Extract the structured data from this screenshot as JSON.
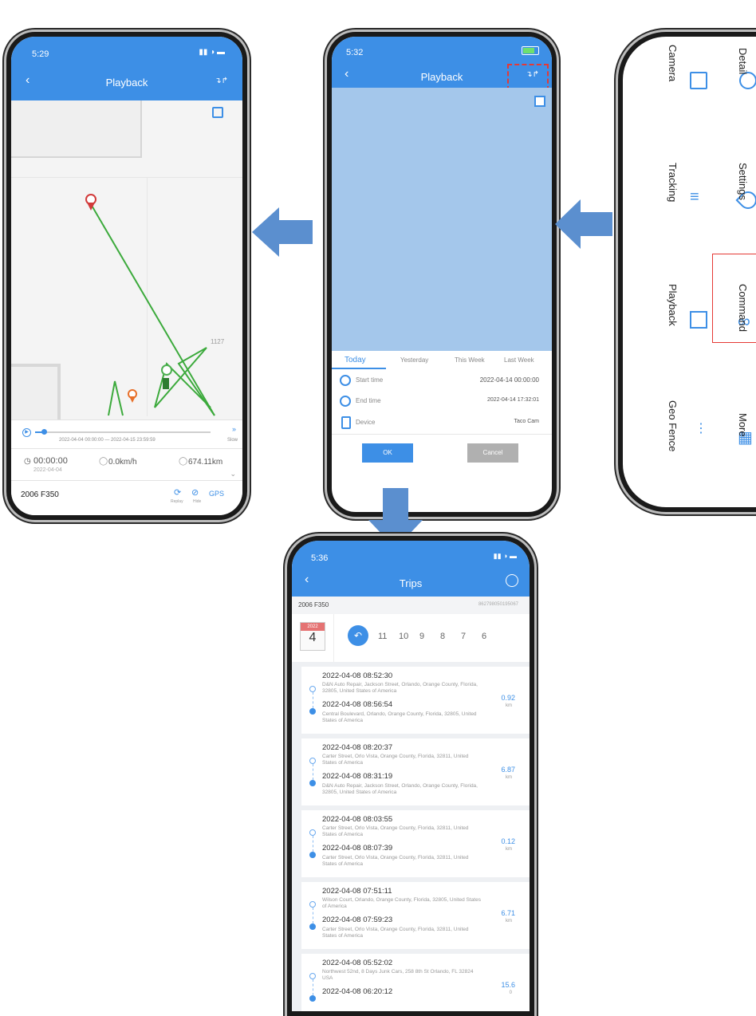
{
  "colors": {
    "brand": "#3d8fe6",
    "route": "#3caa3c",
    "arrow": "#5b8fcf",
    "highlight": "#e53935"
  },
  "left_phone": {
    "status_time": "5:29",
    "title": "Playback",
    "scale_label": "1127",
    "progress_range": "2022-04-04 00:00:00 — 2022-04-15 23:59:59",
    "speed_label": "Slow",
    "progress_fraction": 0.05,
    "elapsed": "00:00:00",
    "elapsed_date": "2022-04-04",
    "speed": "0.0km/h",
    "distance": "674.11km",
    "vehicle": "2006 F350",
    "replay_label": "Replay",
    "hide_label": "Hide",
    "gps_label": "GPS"
  },
  "middle_phone": {
    "status_time": "5:32",
    "title": "Playback",
    "tabs": [
      "Today",
      "Yesterday",
      "This Week",
      "Last Week"
    ],
    "rows": [
      {
        "label": "Start time",
        "value": "2022-04-14 00:00:00"
      },
      {
        "label": "End time",
        "value": "2022-04-14 17:32:01"
      },
      {
        "label": "Device",
        "value": "Taco Cam"
      }
    ],
    "ok": "OK",
    "cancel": "Cancel"
  },
  "right_phone": {
    "menu": [
      {
        "top": "Camera",
        "bottom": "Detail"
      },
      {
        "top": "Tracking",
        "bottom": "Settings"
      },
      {
        "top": "Playback",
        "bottom": "Command"
      },
      {
        "top": "Geo Fence",
        "bottom": "More"
      }
    ]
  },
  "bottom_phone": {
    "status_time": "5:36",
    "title": "Trips",
    "vehicle": "2006 F350",
    "device_id": "862798050195067",
    "calendar_month": "2022",
    "calendar_day": "4",
    "days": [
      "11",
      "10",
      "9",
      "8",
      "7",
      "6"
    ],
    "trips": [
      {
        "start": "2022-04-08 08:52:30",
        "start_addr": "D&N Auto Repair, Jackson Street, Orlando, Orange County, Florida, 32805, United States of America",
        "end": "2022-04-08 08:56:54",
        "end_addr": "Central Boulevard, Orlando, Orange County, Florida, 32805, United States of America",
        "dist": "0.92",
        "unit": "km"
      },
      {
        "start": "2022-04-08 08:20:37",
        "start_addr": "Carter Street, Orlo Vista, Orange County, Florida, 32811, United States of America",
        "end": "2022-04-08 08:31:19",
        "end_addr": "D&N Auto Repair, Jackson Street, Orlando, Orange County, Florida, 32805, United States of America",
        "dist": "6.87",
        "unit": "km"
      },
      {
        "start": "2022-04-08 08:03:55",
        "start_addr": "Carter Street, Orlo Vista, Orange County, Florida, 32811, United States of America",
        "end": "2022-04-08 08:07:39",
        "end_addr": "Carter Street, Orlo Vista, Orange County, Florida, 32811, United States of America",
        "dist": "0.12",
        "unit": "km"
      },
      {
        "start": "2022-04-08 07:51:11",
        "start_addr": "Wilson Court, Orlando, Orange County, Florida, 32805, United States of America",
        "end": "2022-04-08 07:59:23",
        "end_addr": "Carter Street, Orlo Vista, Orange County, Florida, 32811, United States of America",
        "dist": "6.71",
        "unit": "km"
      },
      {
        "start": "2022-04-08 05:52:02",
        "start_addr": "Northwest 52nd, 8 Days Junk Cars, 258 8th St Orlando, FL 32824 USA",
        "end": "2022-04-08 06:20:12",
        "end_addr": "",
        "dist": "15.6",
        "unit": "0"
      }
    ]
  }
}
